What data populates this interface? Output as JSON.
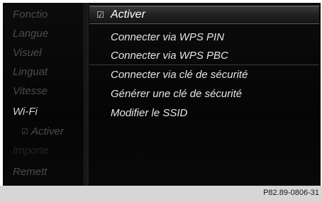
{
  "left_menu": {
    "items": [
      {
        "label": "Fonctio"
      },
      {
        "label": "Langue"
      },
      {
        "label": "Visuel"
      },
      {
        "label": "Linguat"
      },
      {
        "label": "Vitesse"
      },
      {
        "label": "Wi-Fi"
      },
      {
        "label": "Activer",
        "check_icon": "checkbox-checked-icon",
        "check_glyph": "☑"
      },
      {
        "label": "Importe"
      },
      {
        "label": "Remett"
      }
    ]
  },
  "submenu": {
    "items": [
      {
        "label": "Activer",
        "selected": true,
        "check_icon": "checkbox-checked-icon",
        "check_glyph": "☑"
      },
      {
        "label": "Connecter via WPS PIN"
      },
      {
        "label": "Connecter via WPS PBC"
      },
      {
        "label": "Connecter via clé de sécurité"
      },
      {
        "label": "Générer une clé de sécurité"
      },
      {
        "label": "Modifier le SSID"
      }
    ]
  },
  "caption": {
    "code": "P82.89-0806-31"
  },
  "colors": {
    "screen_bg": "#080808",
    "active_text": "#e6e6e6",
    "inactive_text": "#4c4c4c",
    "caption_bg": "#d6d6d6"
  }
}
